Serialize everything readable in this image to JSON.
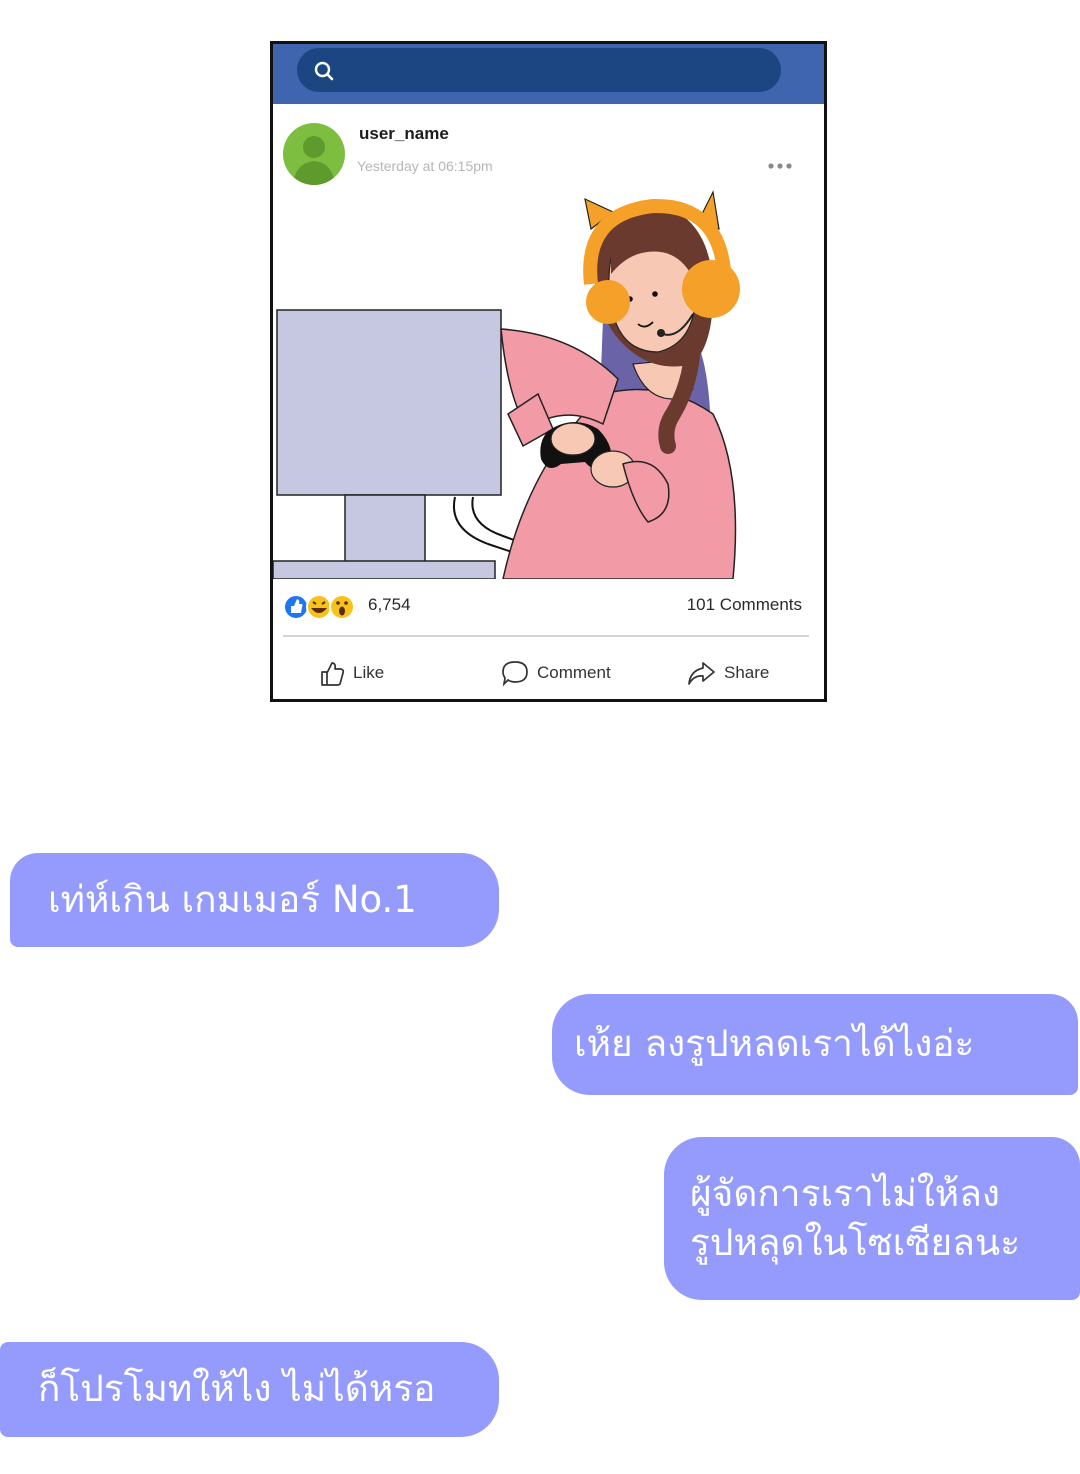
{
  "post": {
    "user_name": "user_name",
    "timestamp": "Yesterday at 06:15pm",
    "reaction_count": "6,754",
    "comment_count": "101 Comments",
    "actions": {
      "like": "Like",
      "comment": "Comment",
      "share": "Share"
    },
    "reaction_icons": [
      "like-icon",
      "haha-icon",
      "wow-icon"
    ]
  },
  "chat": [
    {
      "side": "left",
      "lines": [
        "เท่ห์เกิน เกมเมอร์ No.1"
      ]
    },
    {
      "side": "right",
      "lines": [
        "เห้ย ลงรูปหลดเราได้ไงอ่ะ"
      ]
    },
    {
      "side": "right",
      "lines": [
        "ผู้จัดการเราไม่ให้ลง",
        "รูปหลุดในโซเซียลนะ"
      ]
    },
    {
      "side": "left",
      "lines": [
        "ก็โปรโมทให้ไง ไม่ได้หรอ"
      ]
    }
  ],
  "colors": {
    "header": "#3f65ae",
    "search": "#1c4682",
    "bubble": "#959bfc",
    "avatar": "#7dbd3f"
  }
}
